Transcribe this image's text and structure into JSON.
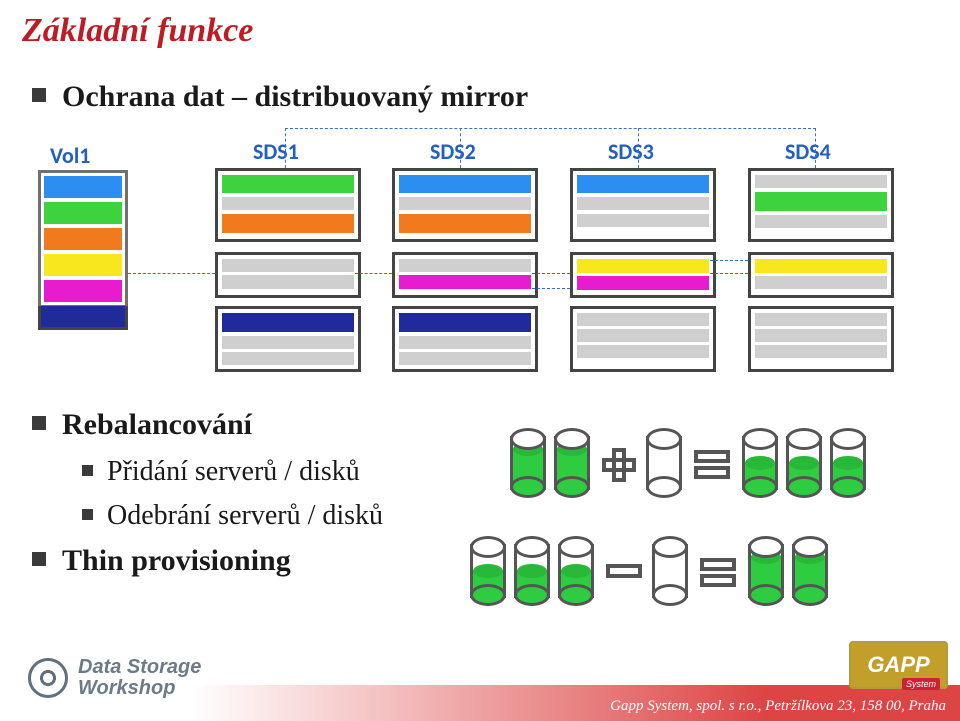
{
  "title": "Základní funkce",
  "bullets": {
    "b1": "Ochrana dat – distribuovaný mirror",
    "b2": "Rebalancování",
    "b2a": "Přidání serverů / disků",
    "b2b": "Odebrání serverů / disků",
    "b3": "Thin provisioning"
  },
  "diagram": {
    "vol_label": "Vol1",
    "cols": [
      "SDS1",
      "SDS2",
      "SDS3",
      "SDS4"
    ]
  },
  "footer": {
    "text": "Gapp System, spol. s r.o., Petržílkova 23, 158 00, Praha",
    "logo_left_line1": "Data Storage",
    "logo_left_line2": "Workshop",
    "logo_right": "GAPP",
    "logo_right_sub": "System"
  }
}
